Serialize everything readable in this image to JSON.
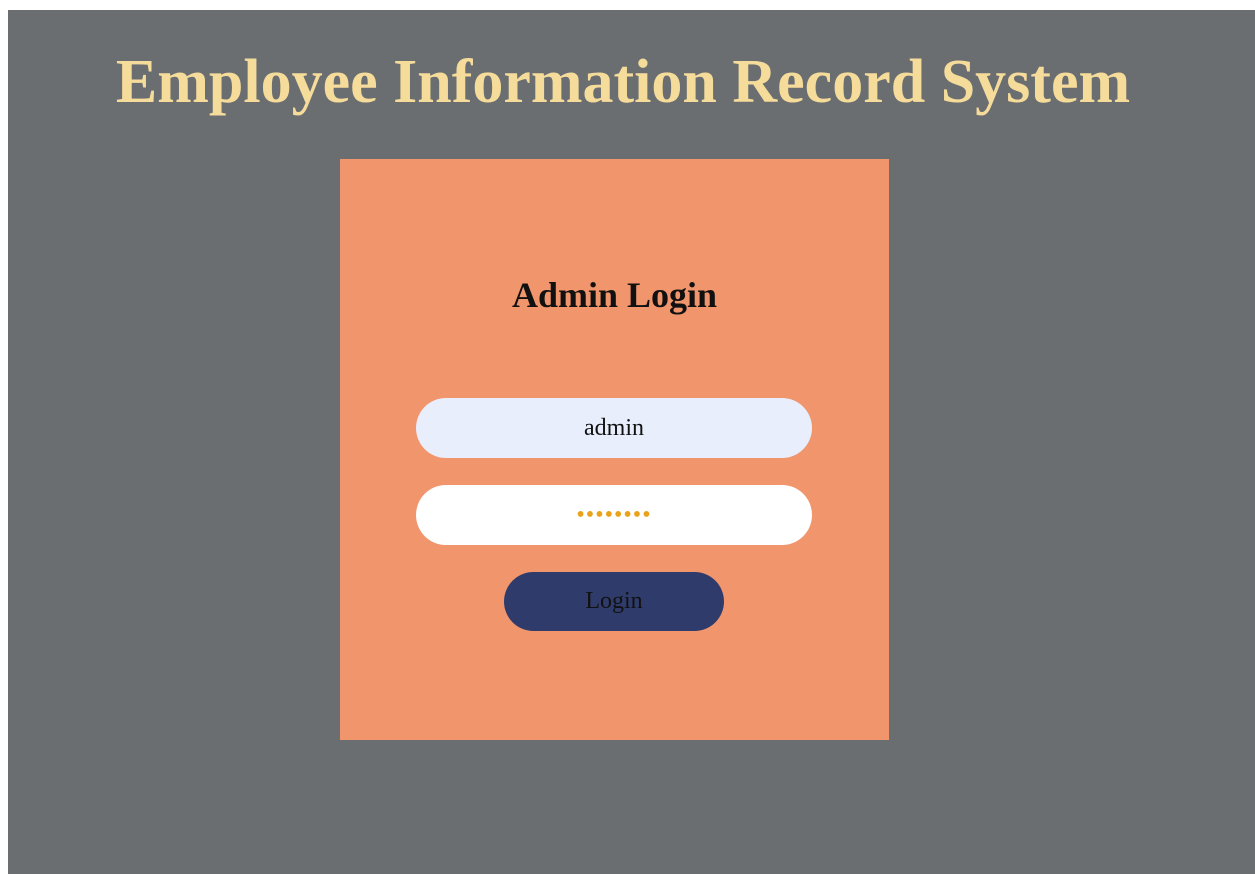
{
  "app": {
    "title": "Employee Information Record System"
  },
  "login": {
    "heading": "Admin Login",
    "username_value": "admin",
    "password_value": "password",
    "login_button_label": "Login"
  },
  "colors": {
    "page_background": "#6b6e71",
    "title_color": "#f5dc9a",
    "card_background": "#f1956c",
    "username_field_background": "#e8eefb",
    "password_field_background": "#ffffff",
    "button_background": "#2f3c6b"
  }
}
